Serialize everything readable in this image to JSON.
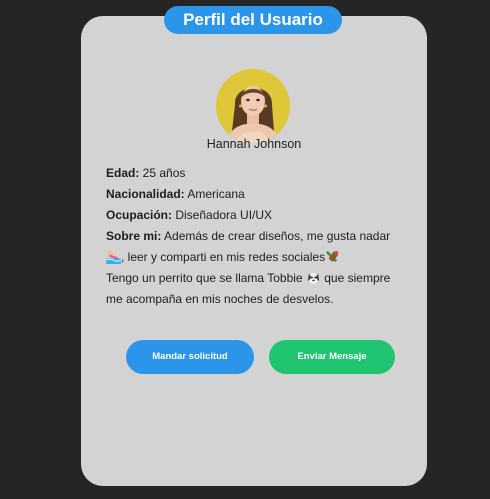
{
  "profile": {
    "title": "Perfil del Usuario",
    "name": "Hannah Johnson",
    "avatar_icon": "user-photo-avatar"
  },
  "details": {
    "age_label": "Edad:",
    "age_value": " 25 años",
    "nationality_label": "Nacionalidad:",
    "nationality_value": " Americana",
    "occupation_label": "Ocupación:",
    "occupation_value": " Diseñadora UI/UX",
    "about_label": "Sobre mi:",
    "about_line1": " Además de crear diseños, me gusta nadar ",
    "about_line2": ", leer y comparti en mis redes sociales",
    "about_line3": "Tengo un perrito que se llama Tobbie ",
    "about_line4": " que siempre me acompaña en mis noches de desvelos.",
    "emoji_swim": "swimmer-emoji-icon",
    "emoji_phone": "phone-emoji-icon",
    "emoji_dog": "dog-emoji-icon"
  },
  "actions": {
    "request_label": "Mandar solicitud",
    "message_label": "Enviar Mensaje"
  },
  "colors": {
    "accent_blue": "#2b95e9",
    "accent_green": "#1ec46f",
    "card_bg": "#d3d3d3",
    "page_bg": "#252525"
  }
}
